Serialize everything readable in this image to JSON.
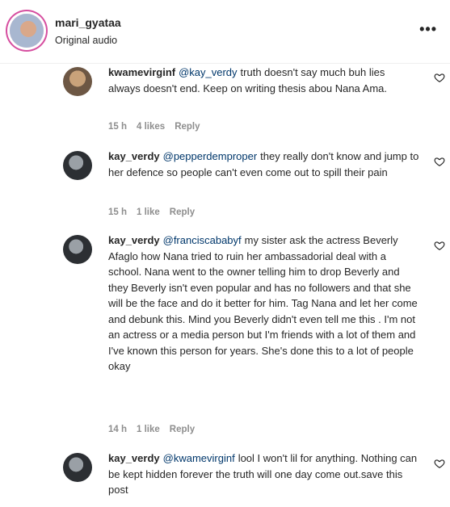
{
  "header": {
    "username": "mari_gyataa",
    "subtitle": "Original audio",
    "more_icon": "•••"
  },
  "comments": [
    {
      "username": "kwamevirginf",
      "mention": "@kay_verdy",
      "text": "truth doesn't say much buh lies always doesn't end. Keep on writing thesis abou Nana Ama.",
      "time": "15 h",
      "likes": "4 likes",
      "reply": "Reply"
    },
    {
      "username": "kay_verdy",
      "mention": "@pepperdemproper",
      "text": "they really don't know and jump to her defence so people can't even come out to spill their pain",
      "time": "15 h",
      "likes": "1 like",
      "reply": "Reply"
    },
    {
      "username": "kay_verdy",
      "mention": "@franciscababyf",
      "text": "my sister ask the actress Beverly Afaglo how Nana tried to ruin her ambassadorial deal with a school. Nana went to the owner telling him to drop Beverly and they Beverly isn't even popular and has no followers and that she will be the face and do it better for him. Tag Nana and let her come and debunk this. Mind you Beverly didn't even tell me this . I'm not an actress or a media person but I'm friends with a lot of them and I've known this person for years. She's done this to a lot of people okay",
      "time": "14 h",
      "likes": "1 like",
      "reply": "Reply"
    },
    {
      "username": "kay_verdy",
      "mention": "@kwamevirginf",
      "text": "lool I won't lil for anything. Nothing can be kept hidden forever the truth will one day come out.save this post",
      "time": "",
      "likes": "",
      "reply": ""
    }
  ]
}
